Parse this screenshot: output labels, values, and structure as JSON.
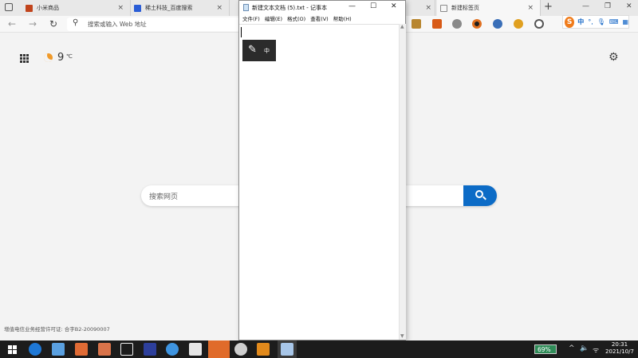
{
  "browser": {
    "tabs": [
      {
        "label": "小米商品",
        "favicon_color": "#c1441c",
        "active": false
      },
      {
        "label": "稀土科技_百度搜索",
        "favicon_color": "#2a5dd6",
        "active": false
      },
      {
        "label": "",
        "favicon_color": "#e0e0e0",
        "active": false
      },
      {
        "label": "",
        "favicon_color": "#e0e0e0",
        "active": false
      },
      {
        "label": "新建标签页",
        "favicon_color": "#8a8a8a",
        "active": true
      }
    ],
    "tab_close_glyph": "×",
    "new_tab_glyph": "+",
    "window_controls": {
      "minimize": "—",
      "maximize": "❐",
      "close": "✕"
    },
    "nav": {
      "back": "←",
      "forward": "→",
      "refresh": "↻"
    },
    "address_placeholder": "搜索或输入 Web 地址",
    "search_glyph": "⚲"
  },
  "newtab": {
    "temperature": "9",
    "temperature_unit": "℃",
    "settings_glyph": "⚙",
    "search_placeholder": "搜索网页",
    "icp_text": "增值电信业务经营许可证: 合字B2-20090007"
  },
  "notepad": {
    "title": "新建文本文档 (5).txt - 记事本",
    "controls": {
      "minimize": "—",
      "maximize": "☐",
      "close": "✕"
    },
    "menu": [
      "文件(F)",
      "编辑(E)",
      "格式(O)",
      "查看(V)",
      "帮助(H)"
    ],
    "ime_popup": {
      "pen_glyph": "✎",
      "label": "中"
    },
    "scroll_up": "▲",
    "scroll_down": "▼"
  },
  "ime_toolbar": {
    "logo": "S",
    "mode": "中",
    "icons": [
      "°,",
      "🎙",
      "⌨",
      "▦"
    ]
  },
  "taskbar": {
    "battery_percent": "69%",
    "tray": {
      "chevron": "^",
      "volume": "🔈",
      "wifi": "ᯤ"
    },
    "time": "20:31",
    "date": "2021/10/7",
    "icon_colors": [
      "#1e78d6",
      "#5aa0e0",
      "#e06b35",
      "#d9734a",
      "#f0f0f0",
      "#2d3f9b",
      "#3e94e0",
      "#e6e6e6",
      "#5a9e4c",
      "#cfcfcf",
      "#e28a1c",
      "#a8c6e8"
    ]
  }
}
